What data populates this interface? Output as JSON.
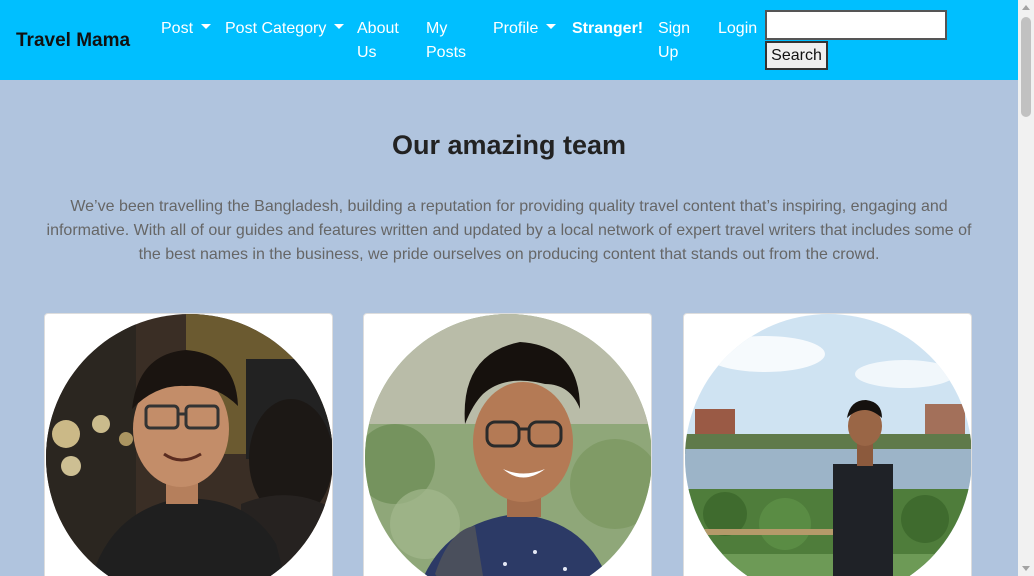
{
  "navbar": {
    "brand": "Travel Mama",
    "items": [
      {
        "label": "Post"
      },
      {
        "label": "Post Category"
      },
      {
        "label": "About Us"
      },
      {
        "label": "My Posts"
      },
      {
        "label": "Profile"
      },
      {
        "label": "Stranger!"
      },
      {
        "label": "Sign Up"
      },
      {
        "label": "Login"
      }
    ],
    "search": {
      "value": "",
      "placeholder": "",
      "button_label": "Search"
    },
    "color": "#00bfff"
  },
  "team": {
    "title": "Our amazing team",
    "intro": "We’ve been travelling the Bangladesh, building a reputation for providing quality travel content that’s inspiring, engaging and informative. With all of our guides and features written and updated by a local network of expert travel writers that includes some of the best names in the business, we pride ourselves on producing content that stands out from the crowd.",
    "members": [
      {
        "photo": "member-1-photo"
      },
      {
        "photo": "member-2-photo"
      },
      {
        "photo": "member-3-photo"
      }
    ]
  },
  "colors": {
    "page_background": "#b0c4de",
    "title": "#222222",
    "intro_text": "#666666"
  }
}
